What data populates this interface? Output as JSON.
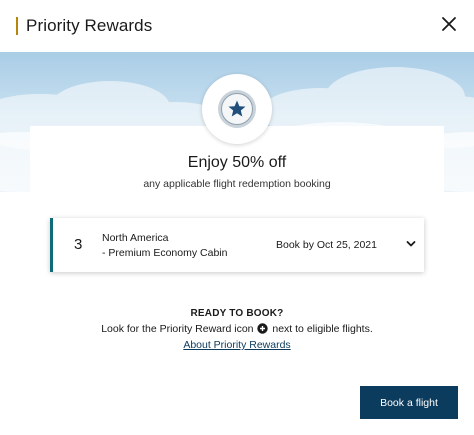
{
  "dialog": {
    "title": "Priority Rewards",
    "close_icon": "close-icon"
  },
  "hero": {
    "badge_icon": "star-icon",
    "headline": "Enjoy 50% off",
    "subline": "any applicable flight redemption booking"
  },
  "reward": {
    "quantity": "3",
    "region": "North America",
    "cabin": "- Premium Economy Cabin",
    "book_by": "Book by Oct 25, 2021",
    "expand_icon": "chevron-down-icon"
  },
  "info": {
    "ready": "READY TO BOOK?",
    "look_before": "Look for the Priority Reward icon",
    "look_after": "next to eligible flights.",
    "look_icon": "plus-circle-icon",
    "about_link": "About Priority Rewards"
  },
  "actions": {
    "book_flight": "Book a flight"
  },
  "colors": {
    "accent_teal": "#0f6b7a",
    "button_navy": "#0b3b5d",
    "title_bar_gold": "#b8860b",
    "star_blue": "#1f4f7a"
  }
}
